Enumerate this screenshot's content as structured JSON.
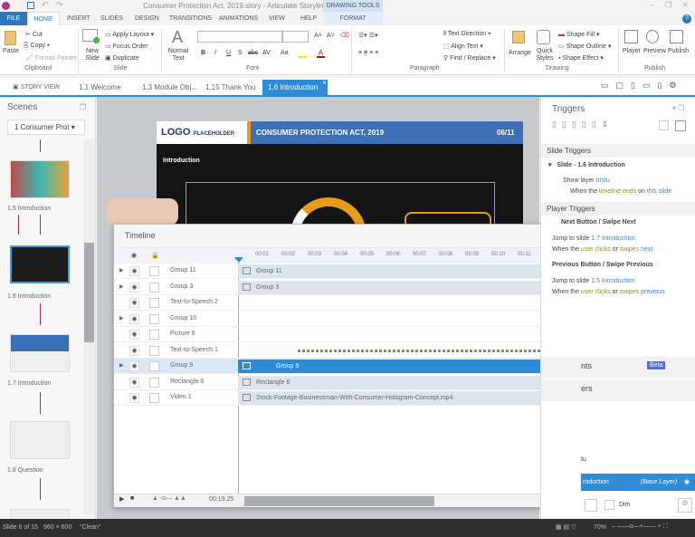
{
  "window": {
    "title": "Consumer Protection Act, 2019.story - Articulate Storyline",
    "contextual_tab": "DRAWING TOOLS"
  },
  "ribbon_tabs": [
    "FILE",
    "HOME",
    "INSERT",
    "SLIDES",
    "DESIGN",
    "TRANSITIONS",
    "ANIMATIONS",
    "VIEW",
    "HELP",
    "FORMAT"
  ],
  "clipboard": {
    "paste": "Paste",
    "cut": "Cut",
    "copy": "Copy",
    "format_painter": "Format Painter",
    "label": "Clipboard"
  },
  "slide_group": {
    "new_slide": "New Slide",
    "apply_layout": "Apply Layout",
    "focus_order": "Focus Order",
    "duplicate": "Duplicate",
    "label": "Slide"
  },
  "font_group": {
    "normal_text": "Normal Text",
    "font_value": "",
    "size_value": "",
    "label": "Font",
    "buttons": [
      "B",
      "I",
      "U",
      "S",
      "abc",
      "AV",
      "Aa"
    ]
  },
  "paragraph": {
    "text_direction": "Text Direction",
    "align_text": "Align Text",
    "find_replace": "Find / Replace",
    "label": "Paragraph"
  },
  "drawing": {
    "arrange": "Arrange",
    "quick_styles": "Quick Styles",
    "shape_fill": "Shape Fill",
    "shape_outline": "Shape Outline",
    "shape_effect": "Shape Effect",
    "label": "Drawing"
  },
  "publish": {
    "player": "Player",
    "preview": "Preview",
    "publish": "Publish",
    "label": "Publish"
  },
  "slide_tabs": [
    {
      "label": "STORY VIEW"
    },
    {
      "label": "1.1 Welcome"
    },
    {
      "label": "1.3 Module Obj..."
    },
    {
      "label": "1.15 Thank You"
    },
    {
      "label": "1.6 Introduction",
      "active": true
    }
  ],
  "scenes": {
    "title": "Scenes",
    "dropdown": "1 Consumer Prot",
    "slides": [
      "1.5 Introduction",
      "1.6 Introduction",
      "1.7 Introduction",
      "1.8 Question"
    ],
    "selected": "1.6 Introduction"
  },
  "slide": {
    "logo": "LOGO",
    "logo_sub": "PLACEHOLDER",
    "header": "CONSUMER PROTECTION ACT, 2019",
    "page": "06/11",
    "section": "Introduction"
  },
  "timeline": {
    "title": "Timeline",
    "ticks": [
      "00:01",
      "00:02",
      "00:03",
      "00:04",
      "00:05",
      "00:06",
      "00:07",
      "00:08",
      "00:09",
      "00:10",
      "00:11",
      "00:12"
    ],
    "rows": [
      {
        "name": "Group 11",
        "bar": "Group 11",
        "expand": true
      },
      {
        "name": "Group 3",
        "bar": "Group 3",
        "expand": true
      },
      {
        "name": "Text-to-Speech 2",
        "bar": ""
      },
      {
        "name": "Group 10",
        "bar": "",
        "expand": true
      },
      {
        "name": "Picture 6",
        "bar": ""
      },
      {
        "name": "Text-to-Speech 1",
        "bar": ""
      },
      {
        "name": "Group 9",
        "bar": "Group 9",
        "expand": true,
        "selected": true
      },
      {
        "name": "Rectangle 6",
        "bar": "Rectangle 6"
      },
      {
        "name": "Video 1",
        "bar": "Stock-Footage-Businessman-With-Consumer-Hologram-Concept.mp4"
      }
    ],
    "duration": "00:19.25"
  },
  "triggers": {
    "title": "Triggers",
    "slide_triggers": "Slide Triggers",
    "slide_item": "Slide - 1.6 Introduction",
    "t1_action": "Show layer",
    "t1_target": "Instu",
    "t1_when": "When the",
    "t1_event": "timeline ends",
    "t1_on": "on",
    "t1_obj": "this slide",
    "player_triggers": "Player Triggers",
    "next": "Next Button / Swipe Next",
    "next_action": "Jump to slide",
    "next_target": "1.7 Introduction",
    "next_when": "When the",
    "next_user": "user clicks",
    "next_or": "or",
    "next_swipes": "swipes",
    "next_dir": "next",
    "prev": "Previous Button / Swipe Previous",
    "prev_target": "1.5 Introduction",
    "prev_dir": "previous"
  },
  "states": {
    "label": "nts",
    "badge": "Beta"
  },
  "layers": {
    "label": "ers",
    "layer": "tu",
    "base": "roduction",
    "base_tag": "(Base Layer)",
    "dim": "Dim"
  },
  "status": {
    "slide": "Slide 6 of 15",
    "size": "960 × 600",
    "theme": "\"Clean\"",
    "zoom": "70%"
  },
  "colors": {
    "accent": "#2e8bd6",
    "file_tab": "#2b79c2",
    "slide_header": "#3d6fb6",
    "orange": "#e89b1a"
  }
}
